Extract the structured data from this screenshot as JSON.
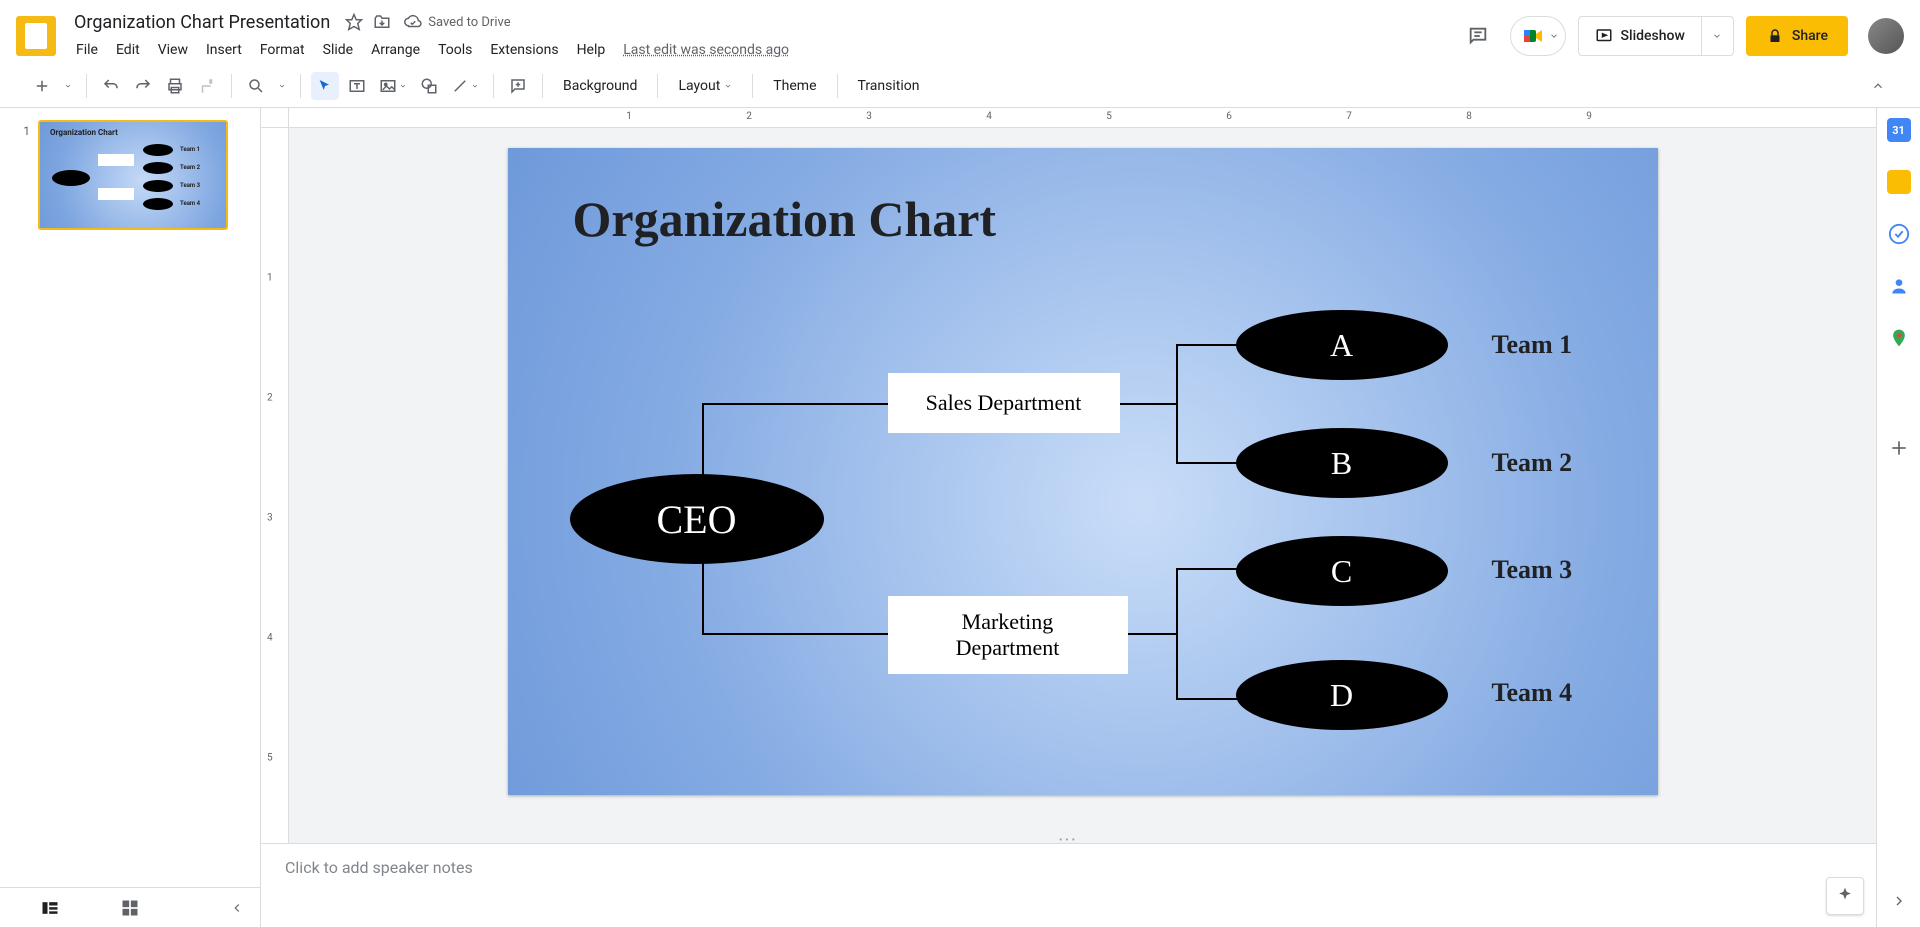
{
  "doc": {
    "title": "Organization Chart Presentation",
    "saved": "Saved to Drive",
    "lastEdit": "Last edit was seconds ago"
  },
  "menus": [
    "File",
    "Edit",
    "View",
    "Insert",
    "Format",
    "Slide",
    "Arrange",
    "Tools",
    "Extensions",
    "Help"
  ],
  "toolbar": {
    "background": "Background",
    "layout": "Layout",
    "theme": "Theme",
    "transition": "Transition"
  },
  "header": {
    "slideshow": "Slideshow",
    "share": "Share"
  },
  "slideNumber": "1",
  "notes": {
    "placeholder": "Click to add speaker notes"
  },
  "rulerH": [
    "1",
    "2",
    "3",
    "4",
    "5",
    "6",
    "7",
    "8",
    "9"
  ],
  "rulerV": [
    "1",
    "2",
    "3",
    "4",
    "5"
  ],
  "chart_data": {
    "type": "diagram",
    "title": "Organization Chart",
    "root": {
      "id": "ceo",
      "label": "CEO",
      "shape": "ellipse"
    },
    "departments": [
      {
        "id": "sales",
        "label": "Sales Department",
        "shape": "rect",
        "teams": [
          {
            "id": "a",
            "node": "A",
            "label": "Team 1"
          },
          {
            "id": "b",
            "node": "B",
            "label": "Team 2"
          }
        ]
      },
      {
        "id": "marketing",
        "label": "Marketing\nDepartment",
        "shape": "rect",
        "teams": [
          {
            "id": "c",
            "node": "C",
            "label": "Team 3"
          },
          {
            "id": "d",
            "node": "D",
            "label": "Team 4"
          }
        ]
      }
    ]
  }
}
